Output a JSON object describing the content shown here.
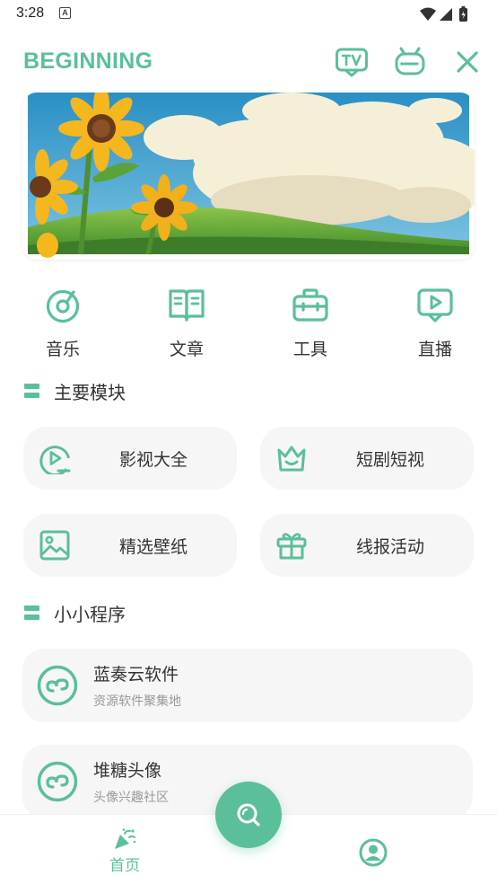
{
  "status_bar": {
    "time": "3:28",
    "notif_letter": "A"
  },
  "header": {
    "title": "BEGINNING",
    "icons": [
      "tv-icon",
      "robot-icon",
      "close-icon"
    ]
  },
  "quick_nav": [
    {
      "label": "音乐",
      "icon": "music-disc-icon"
    },
    {
      "label": "文章",
      "icon": "book-icon"
    },
    {
      "label": "工具",
      "icon": "toolbox-icon"
    },
    {
      "label": "直播",
      "icon": "live-play-icon"
    }
  ],
  "sections": {
    "main_modules": "主要模块",
    "mini_programs": "小小程序"
  },
  "modules": [
    {
      "label": "影视大全",
      "icon": "video-reel-icon"
    },
    {
      "label": "短剧短视",
      "icon": "crown-icon"
    },
    {
      "label": "精选壁纸",
      "icon": "image-icon"
    },
    {
      "label": "线报活动",
      "icon": "gift-icon"
    }
  ],
  "mini_programs": [
    {
      "title": "蓝奏云软件",
      "subtitle": "资源软件聚集地",
      "icon": "mini-program-icon"
    },
    {
      "title": "堆糖头像",
      "subtitle": "头像兴趣社区",
      "icon": "mini-program-icon"
    }
  ],
  "bottom_nav": {
    "home_label": "首页"
  },
  "colors": {
    "accent": "#5bbf9a",
    "card_bg": "#f6f6f6",
    "text": "#333333",
    "subtext": "#999999"
  }
}
